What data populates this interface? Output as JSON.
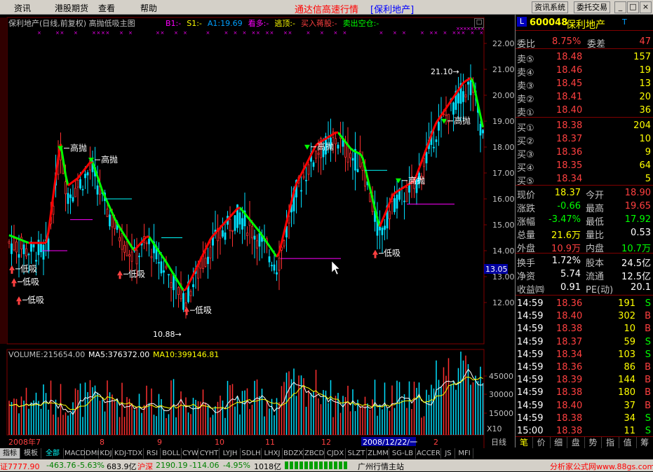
{
  "menu": {
    "items": [
      "资讯",
      "港股期货",
      "查看",
      "帮助"
    ],
    "app_title": "通达信高速行情",
    "stock_title": "[保利地产]",
    "btn_info": "资讯系统",
    "btn_trade": "委托交易"
  },
  "chart": {
    "title": "保利地产(日线,前复权) 高抛低吸主图",
    "legend": [
      {
        "t": "B1:-",
        "c": "#ff00ff"
      },
      {
        "t": "S1:-",
        "c": "#ffff00"
      },
      {
        "t": "A1:19.69",
        "c": "#00a0ff"
      },
      {
        "t": "看多:-",
        "c": "#ff00ff"
      },
      {
        "t": "逃顶:-",
        "c": "#ffff00"
      },
      {
        "t": "买入蒋股:-",
        "c": "#ff4040"
      },
      {
        "t": "卖出空仓:-",
        "c": "#00ff00"
      }
    ],
    "y_ticks": [
      "22.00",
      "21.00",
      "20.00",
      "19.00",
      "18.00",
      "17.00",
      "16.00",
      "15.00",
      "14.00",
      "13.00",
      "12.00"
    ],
    "current_price_label": "13.05",
    "labels": {
      "high_label": "高抛",
      "low_label": "低吸",
      "max_note": "21.10",
      "min_note": "10.88"
    },
    "vol_title": "VOLUME:215654.00",
    "vol_ma5": "MA5:376372.00",
    "vol_ma10": "MA10:399146.81",
    "vol_ticks": [
      "45000",
      "30000",
      "15000"
    ],
    "vol_unit": "X10",
    "x_labels": [
      "2008年7",
      "8",
      "9",
      "10",
      "11",
      "12",
      "2008/12/22/一",
      "2"
    ],
    "period": "日线"
  },
  "panel": {
    "code": "600048",
    "name": "保利地产",
    "badge": "L",
    "t_mark": "T",
    "weibi_label": "委比",
    "weibi": "8.75%",
    "weicha_label": "委差",
    "weicha": "47",
    "asks": [
      {
        "l": "卖⑤",
        "p": "18.48",
        "v": "157"
      },
      {
        "l": "卖④",
        "p": "18.46",
        "v": "19"
      },
      {
        "l": "卖③",
        "p": "18.45",
        "v": "13"
      },
      {
        "l": "卖②",
        "p": "18.41",
        "v": "20"
      },
      {
        "l": "卖①",
        "p": "18.40",
        "v": "36"
      }
    ],
    "bids": [
      {
        "l": "买①",
        "p": "18.38",
        "v": "204"
      },
      {
        "l": "买②",
        "p": "18.37",
        "v": "10"
      },
      {
        "l": "买③",
        "p": "18.36",
        "v": "9"
      },
      {
        "l": "买④",
        "p": "18.35",
        "v": "64"
      },
      {
        "l": "买⑤",
        "p": "18.34",
        "v": "5"
      }
    ],
    "stats": [
      {
        "l1": "现价",
        "v1": "18.37",
        "c1": "#ffff00",
        "l2": "今开",
        "v2": "18.90",
        "c2": "#ff4040"
      },
      {
        "l1": "涨跌",
        "v1": "-0.66",
        "c1": "#00ff00",
        "l2": "最高",
        "v2": "19.65",
        "c2": "#ff4040"
      },
      {
        "l1": "涨幅",
        "v1": "-3.47%",
        "c1": "#00ff00",
        "l2": "最低",
        "v2": "17.92",
        "c2": "#00ff00"
      },
      {
        "l1": "总量",
        "v1": "21.6万",
        "c1": "#ffff00",
        "l2": "量比",
        "v2": "0.53",
        "c2": "#ffffff"
      },
      {
        "l1": "外盘",
        "v1": "10.9万",
        "c1": "#ff4040",
        "l2": "内盘",
        "v2": "10.7万",
        "c2": "#00ff00"
      }
    ],
    "fin": [
      {
        "l1": "换手",
        "v1": "1.72%",
        "l2": "股本",
        "v2": "24.5亿"
      },
      {
        "l1": "净资",
        "v1": "5.74",
        "l2": "流通",
        "v2": "12.5亿"
      },
      {
        "l1": "收益㈣",
        "v1": "0.91",
        "l2": "PE(动)",
        "v2": "20.1"
      }
    ],
    "ticks": [
      {
        "t": "14:59",
        "p": "18.36",
        "v": "191",
        "s": "S",
        "c": "#00ff00"
      },
      {
        "t": "14:59",
        "p": "18.40",
        "v": "302",
        "s": "B",
        "c": "#ff4040"
      },
      {
        "t": "14:59",
        "p": "18.38",
        "v": "10",
        "s": "B",
        "c": "#ff4040"
      },
      {
        "t": "14:59",
        "p": "18.37",
        "v": "59",
        "s": "S",
        "c": "#00ff00"
      },
      {
        "t": "14:59",
        "p": "18.34",
        "v": "103",
        "s": "S",
        "c": "#00ff00"
      },
      {
        "t": "14:59",
        "p": "18.36",
        "v": "86",
        "s": "B",
        "c": "#ff4040"
      },
      {
        "t": "14:59",
        "p": "18.39",
        "v": "144",
        "s": "B",
        "c": "#ff4040"
      },
      {
        "t": "14:59",
        "p": "18.38",
        "v": "180",
        "s": "B",
        "c": "#ff4040"
      },
      {
        "t": "14:59",
        "p": "18.40",
        "v": "37",
        "s": "B",
        "c": "#ff4040"
      },
      {
        "t": "14:59",
        "p": "18.38",
        "v": "34",
        "s": "S",
        "c": "#00ff00"
      },
      {
        "t": "15:00",
        "p": "18.38",
        "v": "11",
        "s": "S",
        "c": "#00ff00"
      }
    ],
    "bottom_tabs": [
      "笔",
      "价",
      "细",
      "盘",
      "势",
      "指",
      "值",
      "筹"
    ]
  },
  "indicators": {
    "tabs": [
      "指标",
      "模板",
      "全部",
      "MACD",
      "DMI",
      "KDJ",
      "KDJ-TDX",
      "RSI",
      "BOLL",
      "CYW",
      "CYHT",
      "LYJH",
      "SDLH",
      "LHXJ",
      "BDZX",
      "ZBCD",
      "CJDX",
      "SLZT",
      "ZLMM",
      "SG-LB",
      "ACCER",
      "JS",
      "MFI"
    ]
  },
  "status": {
    "sh": "证7777.90",
    "sh_chg": "-463.76",
    "sh_pct": "-5.63%",
    "sh_amt": "683.9亿",
    "sz_label": "沪深",
    "sz": "2190.19",
    "sz_chg": "-114.06",
    "sz_pct": "-4.95%",
    "sz_amt": "1018亿",
    "server": "广州行情主站",
    "site": "分析家公式网www.88gs.com"
  },
  "colors": {
    "up": "#ff3030",
    "down": "#00e0ff",
    "grid": "#800000",
    "text": "#c0c0c0",
    "green": "#00ff00",
    "yellow": "#ffff00"
  }
}
